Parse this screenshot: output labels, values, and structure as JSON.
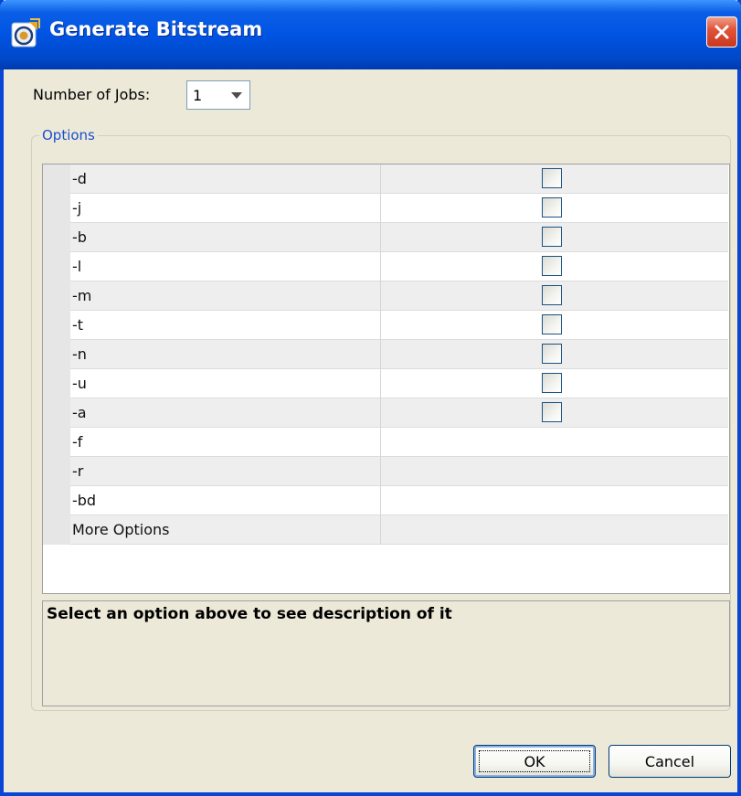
{
  "window": {
    "title": "Generate Bitstream"
  },
  "jobs": {
    "label": "Number of Jobs:",
    "value": "1"
  },
  "options": {
    "group_label": "Options",
    "rows": [
      {
        "name": "-d",
        "has_checkbox": true,
        "checked": false
      },
      {
        "name": "-j",
        "has_checkbox": true,
        "checked": false
      },
      {
        "name": "-b",
        "has_checkbox": true,
        "checked": false
      },
      {
        "name": "-l",
        "has_checkbox": true,
        "checked": false
      },
      {
        "name": "-m",
        "has_checkbox": true,
        "checked": false
      },
      {
        "name": "-t",
        "has_checkbox": true,
        "checked": false
      },
      {
        "name": "-n",
        "has_checkbox": true,
        "checked": false
      },
      {
        "name": "-u",
        "has_checkbox": true,
        "checked": false
      },
      {
        "name": "-a",
        "has_checkbox": true,
        "checked": false
      },
      {
        "name": "-f",
        "has_checkbox": false
      },
      {
        "name": "-r",
        "has_checkbox": false
      },
      {
        "name": "-bd",
        "has_checkbox": false
      },
      {
        "name": "More Options",
        "has_checkbox": false
      }
    ]
  },
  "description": {
    "text": "Select an option above to see description of it"
  },
  "buttons": {
    "ok_label": "OK",
    "cancel_label": "Cancel"
  },
  "colors": {
    "titlebar": "#0054e3",
    "dialog_bg": "#ece9d8",
    "legend": "#1a4fce",
    "close_button": "#e2543a"
  },
  "icons": {
    "app": "app-logo-icon",
    "close": "close-icon",
    "dropdown": "chevron-down-icon"
  }
}
